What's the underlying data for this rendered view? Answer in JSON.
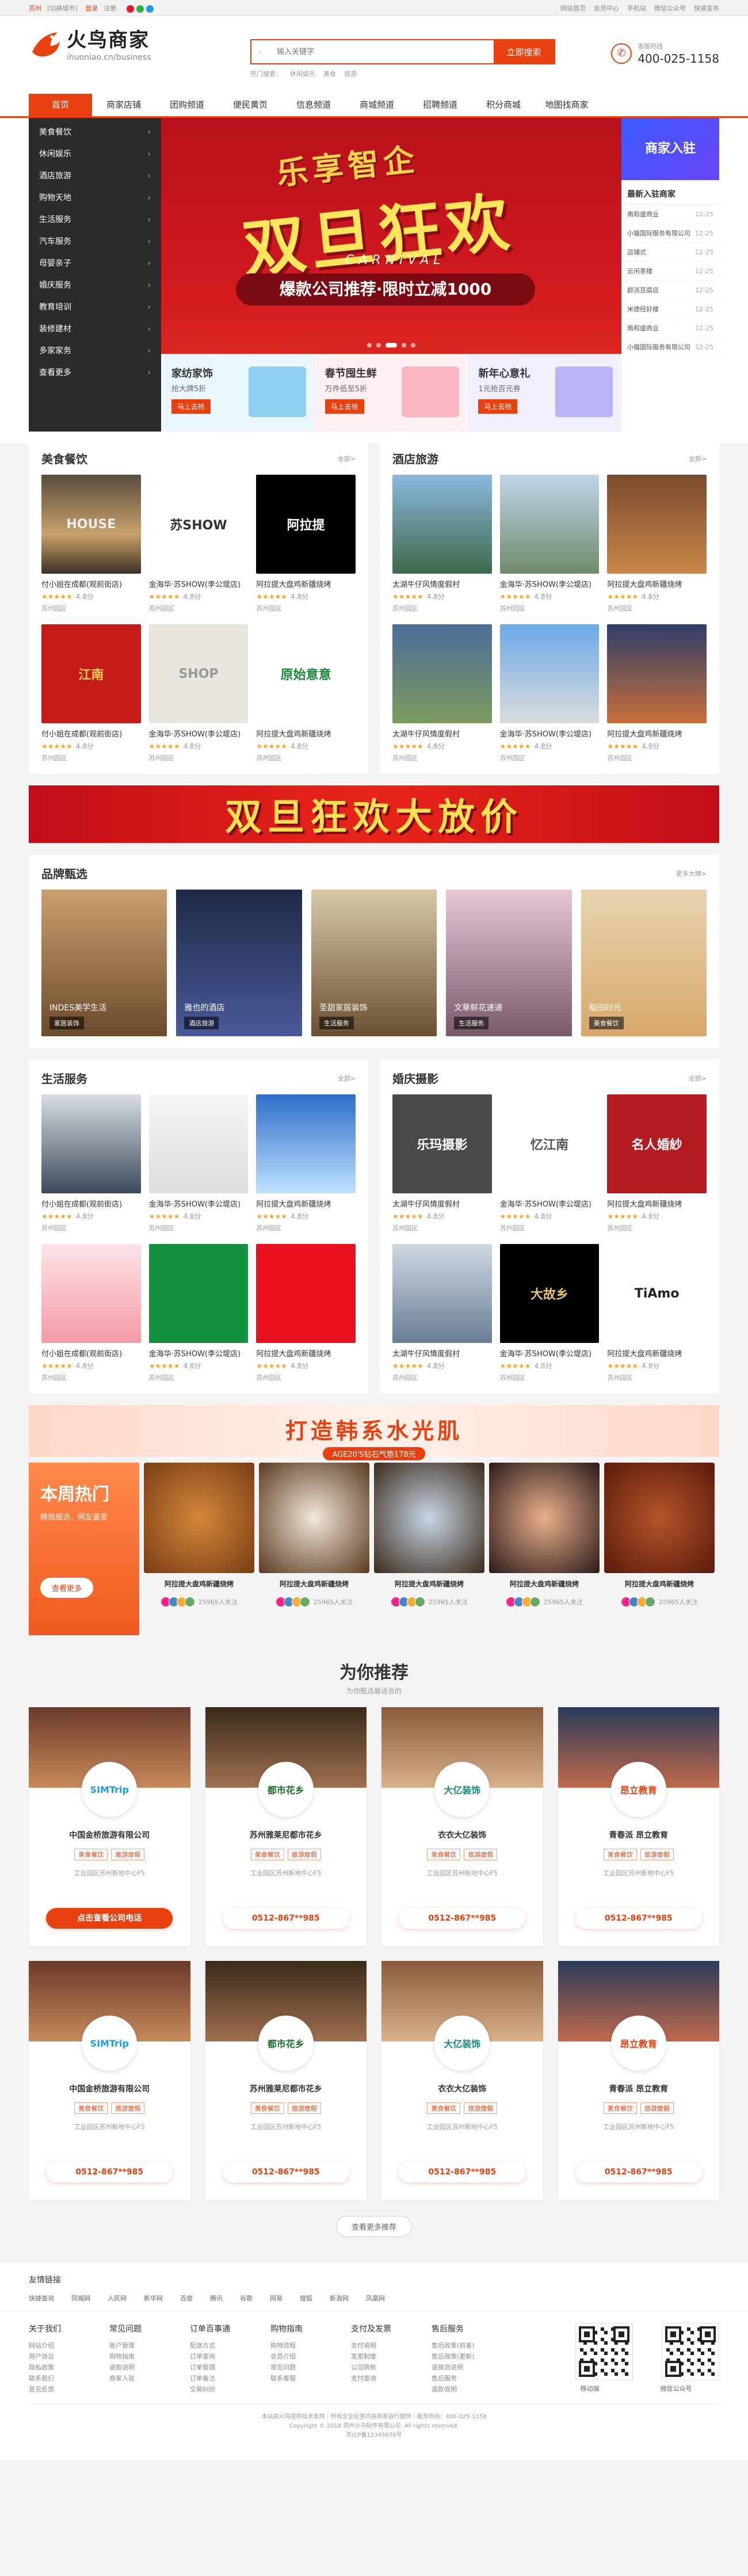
{
  "topbar": {
    "city": "苏州",
    "switch": "[切换城市]",
    "login": "登录",
    "register": "注册",
    "links": [
      "网站首页",
      "会员中心",
      "手机站",
      "微信公众号",
      "快速发布"
    ]
  },
  "brand": {
    "name": "火鸟商家",
    "domain": "ihuoniao.cn/business",
    "accent": "#e8410f"
  },
  "search": {
    "placeholder": "输入关键字",
    "button": "立即搜索",
    "hot": [
      "热门搜索：",
      "休闲娱乐",
      "美食",
      "旅游"
    ]
  },
  "phone": {
    "label": "客服热线",
    "number": "400-025-1158"
  },
  "nav": [
    "首页",
    "商家店铺",
    "团购频道",
    "便民黄页",
    "信息频道",
    "商城频道",
    "招聘频道",
    "积分商城",
    "地图找商家"
  ],
  "categories": [
    "美食餐饮",
    "休闲娱乐",
    "酒店旅游",
    "购物天地",
    "生活服务",
    "汽车服务",
    "母婴亲子",
    "婚庆服务",
    "教育培训",
    "装修建材",
    "多家家务",
    "查看更多"
  ],
  "banner": {
    "t1": "乐享智企",
    "t2": "双旦狂欢",
    "t3": "CARNIVAL",
    "t4": "爆款公司推荐·限时立减1000"
  },
  "promos": [
    {
      "title": "家纺家饰",
      "sub": "抢大牌5折",
      "btn": "马上去抢"
    },
    {
      "title": "春节囤生鲜",
      "sub": "万件低至5折",
      "btn": "马上去抢"
    },
    {
      "title": "新年心意礼",
      "sub": "1元抢百元券",
      "btn": "马上去抢"
    }
  ],
  "side": {
    "join": "商家入驻",
    "title": "最新入驻商家",
    "items": [
      {
        "n": "南和盛商业",
        "d": "12-25"
      },
      {
        "n": "小猫国际服务有限公司",
        "d": "12-25"
      },
      {
        "n": "店铺式",
        "d": "12-25"
      },
      {
        "n": "云闲茶楼",
        "d": "12-25"
      },
      {
        "n": "颜派豆腐店",
        "d": "12-25"
      },
      {
        "n": "米德经好楼",
        "d": "12-25"
      },
      {
        "n": "南和盛商业",
        "d": "12-25"
      },
      {
        "n": "小猫国际服务有限公司",
        "d": "12-25"
      }
    ]
  },
  "food": {
    "title": "美食餐饮",
    "more": "全部>",
    "items": [
      {
        "n": "付小姐在成都(观前街店)",
        "s": "★★★★★",
        "r": "4.8分",
        "a": "苏州园区",
        "img": "HOUSE"
      },
      {
        "n": "金海华·苏SHOW(李公堤店)",
        "s": "★★★★★",
        "r": "4.8分",
        "a": "苏州园区",
        "img": "苏SHOW"
      },
      {
        "n": "阿拉提大盘鸡新疆烧烤",
        "s": "★★★★★",
        "r": "4.8分",
        "a": "苏州园区",
        "img": "阿拉提"
      },
      {
        "n": "付小姐在成都(观前街店)",
        "s": "★★★★★",
        "r": "4.8分",
        "a": "苏州园区",
        "img": "江南"
      },
      {
        "n": "金海华·苏SHOW(李公堤店)",
        "s": "★★★★★",
        "r": "4.8分",
        "a": "苏州园区",
        "img": "SHOP"
      },
      {
        "n": "阿拉提大盘鸡新疆烧烤",
        "s": "★★★★★",
        "r": "4.8分",
        "a": "苏州园区",
        "img": "原始意意"
      }
    ]
  },
  "hotel": {
    "title": "酒店旅游",
    "more": "全部>",
    "items": [
      {
        "n": "太湖牛仔风情度假村",
        "s": "★★★★★",
        "r": "4.8分",
        "a": "苏州园区"
      },
      {
        "n": "金海华·苏SHOW(李公堤店)",
        "s": "★★★★★",
        "r": "4.8分",
        "a": "苏州园区"
      },
      {
        "n": "阿拉提大盘鸡新疆烧烤",
        "s": "★★★★★",
        "r": "4.8分",
        "a": "苏州园区"
      },
      {
        "n": "太湖牛仔风情度假村",
        "s": "★★★★★",
        "r": "4.8分",
        "a": "苏州园区"
      },
      {
        "n": "金海华·苏SHOW(李公堤店)",
        "s": "★★★★★",
        "r": "4.8分",
        "a": "苏州园区"
      },
      {
        "n": "阿拉提大盘鸡新疆烧烤",
        "s": "★★★★★",
        "r": "4.8分",
        "a": "苏州园区"
      }
    ]
  },
  "adbar": "双旦狂欢大放价",
  "brands": {
    "title": "品牌甄选",
    "more": "更多大牌>",
    "items": [
      {
        "n": "INDES美学生活",
        "t": "家居装饰"
      },
      {
        "n": "雅也的酒店",
        "t": "酒店旅游"
      },
      {
        "n": "圣甜家居装饰",
        "t": "生活服务"
      },
      {
        "n": "文華鲜花速递",
        "t": "生活服务"
      },
      {
        "n": "稻田时光",
        "t": "美食餐饮"
      }
    ]
  },
  "life": {
    "title": "生活服务",
    "more": "全部>",
    "items": [
      {
        "n": "付小姐在成都(观前街店)",
        "s": "★★★★★",
        "r": "4.8分",
        "a": "苏州园区"
      },
      {
        "n": "金海华·苏SHOW(李公堤店)",
        "s": "★★★★★",
        "r": "4.8分",
        "a": "苏州园区"
      },
      {
        "n": "阿拉提大盘鸡新疆烧烤",
        "s": "★★★★★",
        "r": "4.8分",
        "a": "苏州园区"
      },
      {
        "n": "付小姐在成都(观前街店)",
        "s": "★★★★★",
        "r": "4.8分",
        "a": "苏州园区"
      },
      {
        "n": "金海华·苏SHOW(李公堤店)",
        "s": "★★★★★",
        "r": "4.8分",
        "a": "苏州园区"
      },
      {
        "n": "阿拉提大盘鸡新疆烧烤",
        "s": "★★★★★",
        "r": "4.8分",
        "a": "苏州园区"
      }
    ]
  },
  "wedding": {
    "title": "婚庆摄影",
    "more": "全部>",
    "items": [
      {
        "n": "太湖牛仔风情度假村",
        "s": "★★★★★",
        "r": "4.8分",
        "a": "苏州园区",
        "img": "乐玛摄影"
      },
      {
        "n": "金海华·苏SHOW(李公堤店)",
        "s": "★★★★★",
        "r": "4.8分",
        "a": "苏州园区",
        "img": "忆江南"
      },
      {
        "n": "阿拉提大盘鸡新疆烧烤",
        "s": "★★★★★",
        "r": "4.8分",
        "a": "苏州园区",
        "img": "名人婚紗"
      },
      {
        "n": "太湖牛仔风情度假村",
        "s": "★★★★★",
        "r": "4.8分",
        "a": "苏州园区",
        "img": ""
      },
      {
        "n": "金海华·苏SHOW(李公堤店)",
        "s": "★★★★★",
        "r": "4.8分",
        "a": "苏州园区",
        "img": "大故乡"
      },
      {
        "n": "阿拉提大盘鸡新疆烧烤",
        "s": "★★★★★",
        "r": "4.8分",
        "a": "苏州园区",
        "img": "TiAmo"
      }
    ]
  },
  "adbar2": {
    "t": "打造韩系水光肌",
    "s": "AGE20'S钻石气垫178元"
  },
  "weekly": {
    "title": "本周热门",
    "sub": "精挑细选，网友最爱",
    "btn": "查看更多",
    "items": [
      {
        "n": "阿拉提大盘鸡新疆烧烤",
        "c": "25965人关注"
      },
      {
        "n": "阿拉提大盘鸡新疆烧烤",
        "c": "25965人关注"
      },
      {
        "n": "阿拉提大盘鸡新疆烧烤",
        "c": "25965人关注"
      },
      {
        "n": "阿拉提大盘鸡新疆烧烤",
        "c": "25965人关注"
      },
      {
        "n": "阿拉提大盘鸡新疆烧烤",
        "c": "25965人关注"
      }
    ]
  },
  "recommend": {
    "title": "为你推荐",
    "sub": "为你甄选最适合的",
    "more": "查看更多推荐",
    "items": [
      {
        "n": "中国金桥旅游有限公司",
        "logo": "SIMTrip",
        "t1": "美食餐饮",
        "t2": "旅游度假",
        "a": "工业园区苏州新地中心F5",
        "tel": "点击查看公司电话",
        "on": true
      },
      {
        "n": "苏州雅莱尼都市花乡",
        "logo": "都市花乡",
        "t1": "美食餐饮",
        "t2": "旅游度假",
        "a": "工业园区苏州新地中心F5",
        "tel": "0512-867**985",
        "on": false
      },
      {
        "n": "衣衣大亿装饰",
        "logo": "大亿装饰",
        "t1": "美食餐饮",
        "t2": "旅游度假",
        "a": "工业园区苏州新地中心F5",
        "tel": "0512-867**985",
        "on": false
      },
      {
        "n": "青春派 昂立教育",
        "logo": "昂立教育",
        "t1": "美食餐饮",
        "t2": "旅游度假",
        "a": "工业园区苏州新地中心F5",
        "tel": "0512-867**985",
        "on": false
      },
      {
        "n": "中国金桥旅游有限公司",
        "logo": "SIMTrip",
        "t1": "美食餐饮",
        "t2": "旅游度假",
        "a": "工业园区苏州新地中心F5",
        "tel": "0512-867**985",
        "on": false
      },
      {
        "n": "苏州雅莱尼都市花乡",
        "logo": "都市花乡",
        "t1": "美食餐饮",
        "t2": "旅游度假",
        "a": "工业园区苏州新地中心F5",
        "tel": "0512-867**985",
        "on": false
      },
      {
        "n": "衣衣大亿装饰",
        "logo": "大亿装饰",
        "t1": "美食餐饮",
        "t2": "旅游度假",
        "a": "工业园区苏州新地中心F5",
        "tel": "0512-867**985",
        "on": false
      },
      {
        "n": "青春派 昂立教育",
        "logo": "昂立教育",
        "t1": "美食餐饮",
        "t2": "旅游度假",
        "a": "工业园区苏州新地中心F5",
        "tel": "0512-867**985",
        "on": false
      }
    ]
  },
  "friendlinks": {
    "title": "友情链接",
    "items": [
      "快捷查询",
      "同城网",
      "人民网",
      "新华网",
      "百度",
      "腾讯",
      "谷歌",
      "网易",
      "搜狐",
      "新浪网",
      "凤凰网"
    ]
  },
  "footer": {
    "cols": [
      {
        "t": "关于我们",
        "i": [
          "网站介绍",
          "用户协议",
          "隐私政策",
          "联系我们",
          "意见反馈"
        ]
      },
      {
        "t": "常见问题",
        "i": [
          "账户管理",
          "购物指南",
          "退款说明",
          "商家入驻"
        ]
      },
      {
        "t": "订单百事通",
        "i": [
          "配送方式",
          "订单查询",
          "订单管理",
          "订单备注",
          "交易纠纷"
        ]
      },
      {
        "t": "购物指南",
        "i": [
          "购物流程",
          "会员介绍",
          "常见问题",
          "联系客服"
        ]
      },
      {
        "t": "支付及发票",
        "i": [
          "支付说明",
          "发票制度",
          "公司转账",
          "支付查询"
        ]
      },
      {
        "t": "售后服务",
        "i": [
          "售后政策(前者)",
          "售后政策(更新)",
          "退换货说明",
          "售后服务",
          "退款说明"
        ]
      }
    ],
    "qr1": "移动端",
    "qr2": "微信公众号",
    "copy1": "本站由火鸟提供技术支持｜所有企业信息均由商家自行提供｜服务热线：400-025-1158",
    "copy2": "Copyright © 2018 苏州火鸟软件有限公司. All rights reserved.",
    "copy3": "苏ICP备12345678号"
  }
}
